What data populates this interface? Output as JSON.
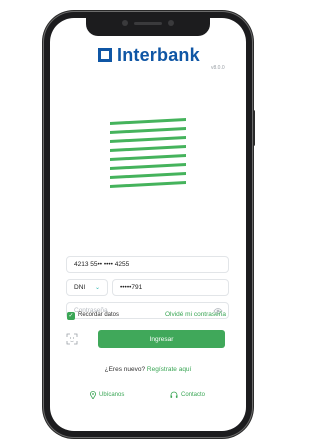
{
  "brand": {
    "name": "Interbank",
    "version": "v8.0.0"
  },
  "login": {
    "card_number": "4213 55•• •••• 4255",
    "doc_type": "DNI",
    "doc_number": "•••••791",
    "password_placeholder": "Contraseña",
    "remember_label": "Recordar datos",
    "forgot_label": "Olvidé mi contraseña",
    "submit_label": "Ingresar",
    "new_prompt": "¿Eres nuevo?",
    "register_label": "Regístrate aquí"
  },
  "footer": {
    "locations_label": "Ubícanos",
    "contact_label": "Contacto"
  },
  "colors": {
    "brand_blue": "#0f56a5",
    "brand_green": "#3aa655"
  },
  "icons": [
    "camera-icon",
    "logo-mark-icon",
    "chevron-down-icon",
    "eye-icon",
    "check-icon",
    "face-id-icon",
    "location-pin-icon",
    "headset-icon"
  ]
}
